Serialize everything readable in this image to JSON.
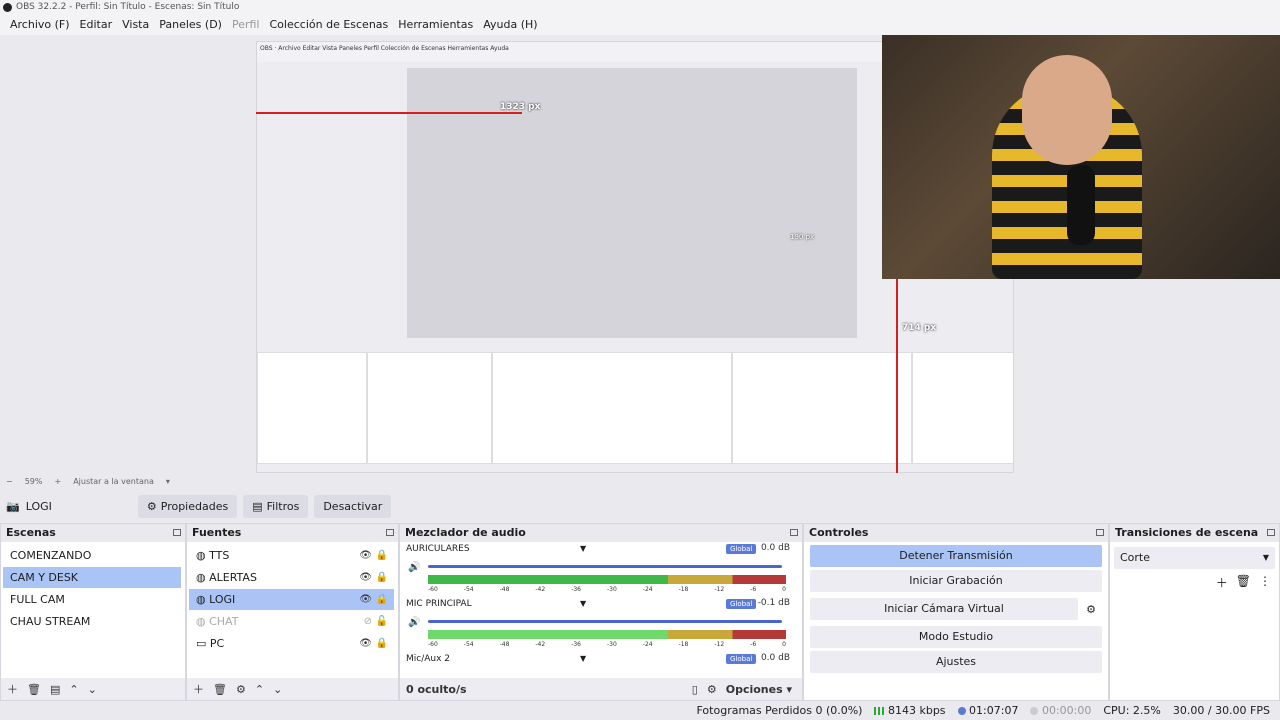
{
  "window": {
    "title": "OBS 32.2.2 - Perfil: Sin Título - Escenas: Sin Título"
  },
  "menu": [
    {
      "label": "Archivo (F)",
      "enabled": true
    },
    {
      "label": "Editar",
      "enabled": true
    },
    {
      "label": "Vista",
      "enabled": true
    },
    {
      "label": "Paneles (D)",
      "enabled": true
    },
    {
      "label": "Perfil",
      "enabled": false
    },
    {
      "label": "Colección de Escenas",
      "enabled": true
    },
    {
      "label": "Herramientas",
      "enabled": true
    },
    {
      "label": "Ayuda (H)",
      "enabled": true
    }
  ],
  "preview": {
    "nested_width_label": "1323 px",
    "nested_height_label": "714 px",
    "nested_inner_label": "190 px",
    "zoom": "59%",
    "fit_label": "Ajustar a la ventana"
  },
  "source_toolbar": {
    "current_source": "LOGI",
    "properties": "Propiedades",
    "filters": "Filtros",
    "deactivate": "Desactivar"
  },
  "scenes": {
    "title": "Escenas",
    "items": [
      "COMENZANDO",
      "CAM Y DESK",
      "FULL CAM",
      "CHAU STREAM"
    ],
    "selected_index": 1
  },
  "sources": {
    "title": "Fuentes",
    "items": [
      {
        "label": "TTS",
        "icon": "browser-icon",
        "visible": true,
        "locked": true
      },
      {
        "label": "ALERTAS",
        "icon": "browser-icon",
        "visible": true,
        "locked": true
      },
      {
        "label": "LOGI",
        "icon": "browser-icon",
        "visible": true,
        "locked": true,
        "selected": true
      },
      {
        "label": "CHAT",
        "icon": "browser-icon",
        "visible": false,
        "locked": false
      },
      {
        "label": "PC",
        "icon": "monitor-icon",
        "visible": true,
        "locked": true
      }
    ]
  },
  "mixer": {
    "title": "Mezclador de audio",
    "channels": [
      {
        "name": "AURICULARES",
        "badge": "Global",
        "db": "0.0 dB",
        "level": 0.85
      },
      {
        "name": "MIC PRINCIPAL",
        "badge": "Global",
        "db": "-0.1 dB",
        "level": 0.67
      },
      {
        "name": "Mic/Aux 2",
        "badge": "Global",
        "db": "0.0 dB",
        "level": 0
      }
    ],
    "scale": [
      "-60",
      "-54",
      "-48",
      "-42",
      "-36",
      "-30",
      "-24",
      "-18",
      "-12",
      "-6",
      "0"
    ],
    "hidden_count": "0 oculto/s",
    "options": "Opciones"
  },
  "controls": {
    "title": "Controles",
    "stop_stream": "Detener Transmisión",
    "start_record": "Iniciar Grabación",
    "start_vcam": "Iniciar Cámara Virtual",
    "studio_mode": "Modo Estudio",
    "settings": "Ajustes"
  },
  "transitions": {
    "title": "Transiciones de escena",
    "selected": "Corte"
  },
  "status": {
    "dropped": "Fotogramas Perdidos 0 (0.0%)",
    "kbps": "8143 kbps",
    "stream_time": "01:07:07",
    "rec_time": "00:00:00",
    "cpu": "CPU: 2.5%",
    "fps": "30.00 / 30.00 FPS"
  },
  "colors": {
    "accent": "#a9c4f5",
    "slider": "#4866cc",
    "meter_green": "#3fb84a",
    "meter_yellow": "#c8a83a",
    "meter_red": "#b43a3a",
    "guide_red": "#d62020"
  }
}
